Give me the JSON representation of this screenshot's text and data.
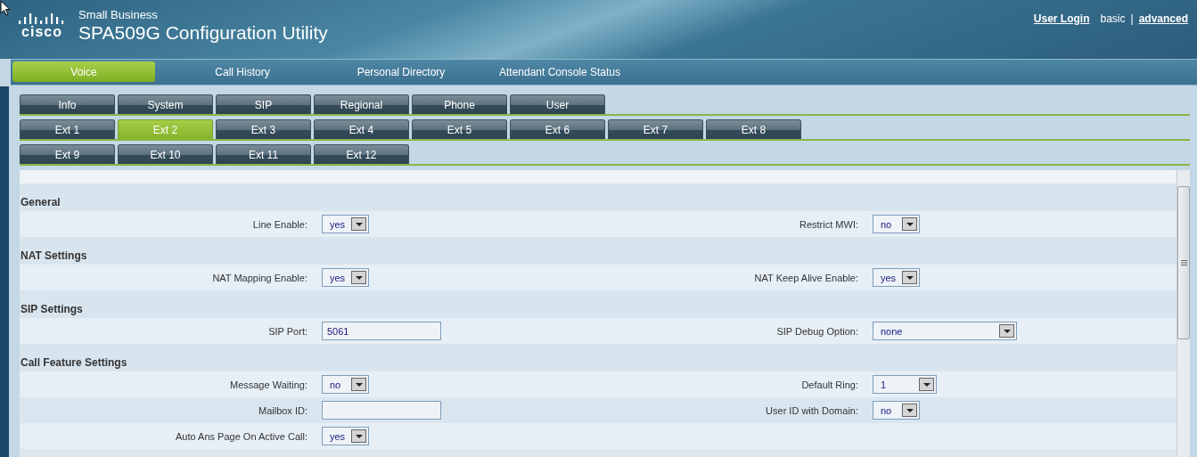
{
  "header": {
    "logo_text": "cisco",
    "brand_line": "Small Business",
    "title": "SPA509G Configuration Utility",
    "links": [
      {
        "label": "User Login",
        "kind": "link"
      },
      {
        "label": "basic",
        "kind": "plain"
      },
      {
        "label": "|",
        "kind": "separator"
      },
      {
        "label": "advanced",
        "kind": "link"
      }
    ]
  },
  "nav": [
    {
      "label": "Voice",
      "selected": true
    },
    {
      "label": "Call History",
      "selected": false
    },
    {
      "label": "Personal Directory",
      "selected": false
    },
    {
      "label": "Attendant Console Status",
      "selected": false
    }
  ],
  "tab_rows": [
    [
      {
        "label": "Info",
        "selected": false
      },
      {
        "label": "System",
        "selected": false
      },
      {
        "label": "SIP",
        "selected": false
      },
      {
        "label": "Regional",
        "selected": false
      },
      {
        "label": "Phone",
        "selected": false
      },
      {
        "label": "User",
        "selected": false
      }
    ],
    [
      {
        "label": "Ext 1",
        "selected": false
      },
      {
        "label": "Ext 2",
        "selected": true
      },
      {
        "label": "Ext 3",
        "selected": false
      },
      {
        "label": "Ext 4",
        "selected": false
      },
      {
        "label": "Ext 5",
        "selected": false
      },
      {
        "label": "Ext 6",
        "selected": false
      },
      {
        "label": "Ext 7",
        "selected": false
      },
      {
        "label": "Ext 8",
        "selected": false
      }
    ],
    [
      {
        "label": "Ext 9",
        "selected": false
      },
      {
        "label": "Ext 10",
        "selected": false
      },
      {
        "label": "Ext 11",
        "selected": false
      },
      {
        "label": "Ext 12",
        "selected": false
      }
    ]
  ],
  "sections": [
    {
      "heading": "General",
      "rows": [
        {
          "left": {
            "label": "Line Enable:",
            "kind": "select",
            "value": "yes"
          },
          "right": {
            "label": "Restrict MWI:",
            "kind": "select",
            "value": "no"
          }
        }
      ]
    },
    {
      "heading": "NAT Settings",
      "rows": [
        {
          "left": {
            "label": "NAT Mapping Enable:",
            "kind": "select",
            "value": "yes"
          },
          "right": {
            "label": "NAT Keep Alive Enable:",
            "kind": "select",
            "value": "yes"
          }
        }
      ]
    },
    {
      "heading": "SIP Settings",
      "rows": [
        {
          "left": {
            "label": "SIP Port:",
            "kind": "text",
            "value": "5061"
          },
          "right": {
            "label": "SIP Debug Option:",
            "kind": "wide-select",
            "value": "none"
          }
        }
      ]
    },
    {
      "heading": "Call Feature Settings",
      "rows": [
        {
          "left": {
            "label": "Message Waiting:",
            "kind": "select",
            "value": "no"
          },
          "right": {
            "label": "Default Ring:",
            "kind": "medium-select",
            "value": "1"
          }
        },
        {
          "left": {
            "label": "Mailbox ID:",
            "kind": "text"
          },
          "right": {
            "label": "User ID with Domain:",
            "kind": "select",
            "value": "no"
          }
        },
        {
          "left": {
            "label": "Auto Ans Page On Active Call:",
            "kind": "select",
            "value": "yes"
          }
        }
      ]
    }
  ]
}
